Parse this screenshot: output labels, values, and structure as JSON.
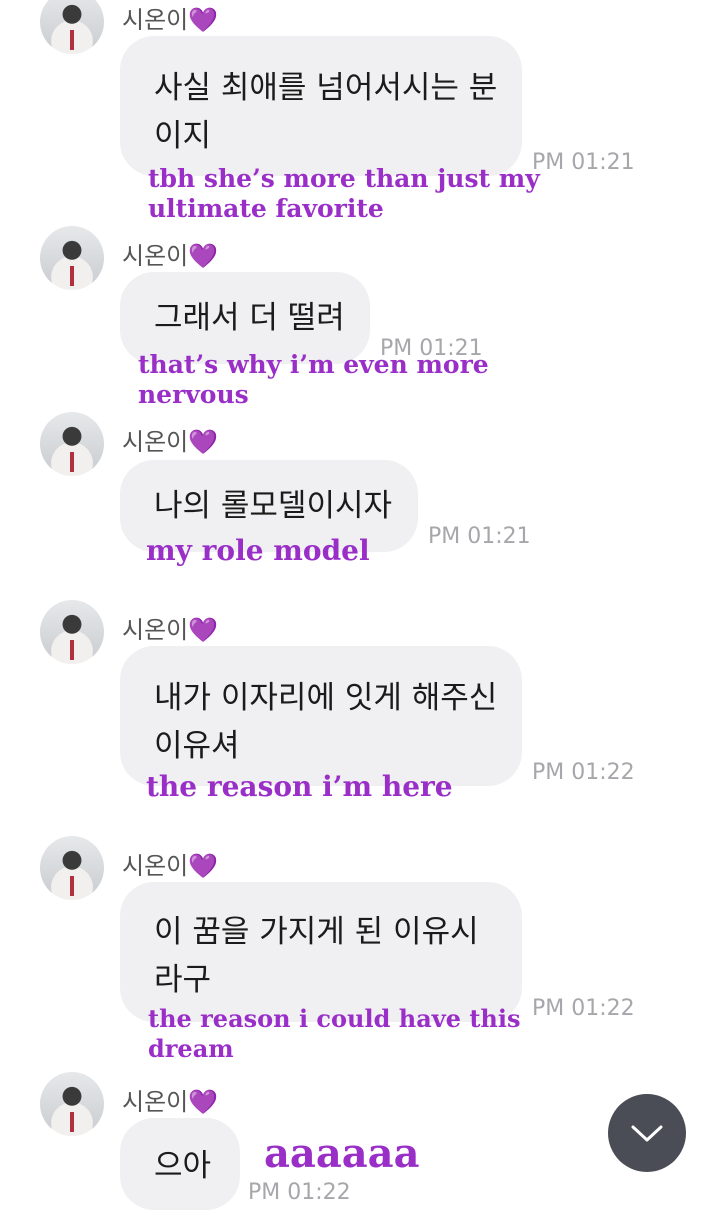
{
  "sender": {
    "name": "시온이",
    "heart": "💜"
  },
  "messages": [
    {
      "korean_lines": [
        "사실 최애를 넘어서시는 분",
        "이지"
      ],
      "time": "PM 01:21",
      "translation_lines": [
        "tbh she’s more than just my",
        "ultimate favorite"
      ]
    },
    {
      "korean_lines": [
        "그래서 더 떨려"
      ],
      "time": "PM 01:21",
      "translation_lines": [
        "that’s why i’m even more",
        "nervous"
      ]
    },
    {
      "korean_lines": [
        "나의 롤모델이시자"
      ],
      "time": "PM 01:21",
      "translation_lines": [
        "my role model"
      ]
    },
    {
      "korean_lines": [
        "내가 이자리에 잇게 해주신",
        "이유셔"
      ],
      "time": "PM 01:22",
      "translation_lines": [
        "the reason i’m here"
      ]
    },
    {
      "korean_lines": [
        "이 꿈을 가지게 된 이유시",
        "라구"
      ],
      "time": "PM 01:22",
      "translation_lines": [
        "the reason i could have this",
        "dream"
      ]
    },
    {
      "korean_lines": [
        "으아"
      ],
      "time": "PM 01:22",
      "translation_lines": [
        "aaaaaa"
      ]
    }
  ],
  "scroll_button": {
    "icon": "chevron-down-icon"
  },
  "colors": {
    "bubble": "#f0f0f2",
    "translation": "#9a2fc8",
    "timestamp": "#a7a7ab",
    "fab": "#4a4c56"
  }
}
